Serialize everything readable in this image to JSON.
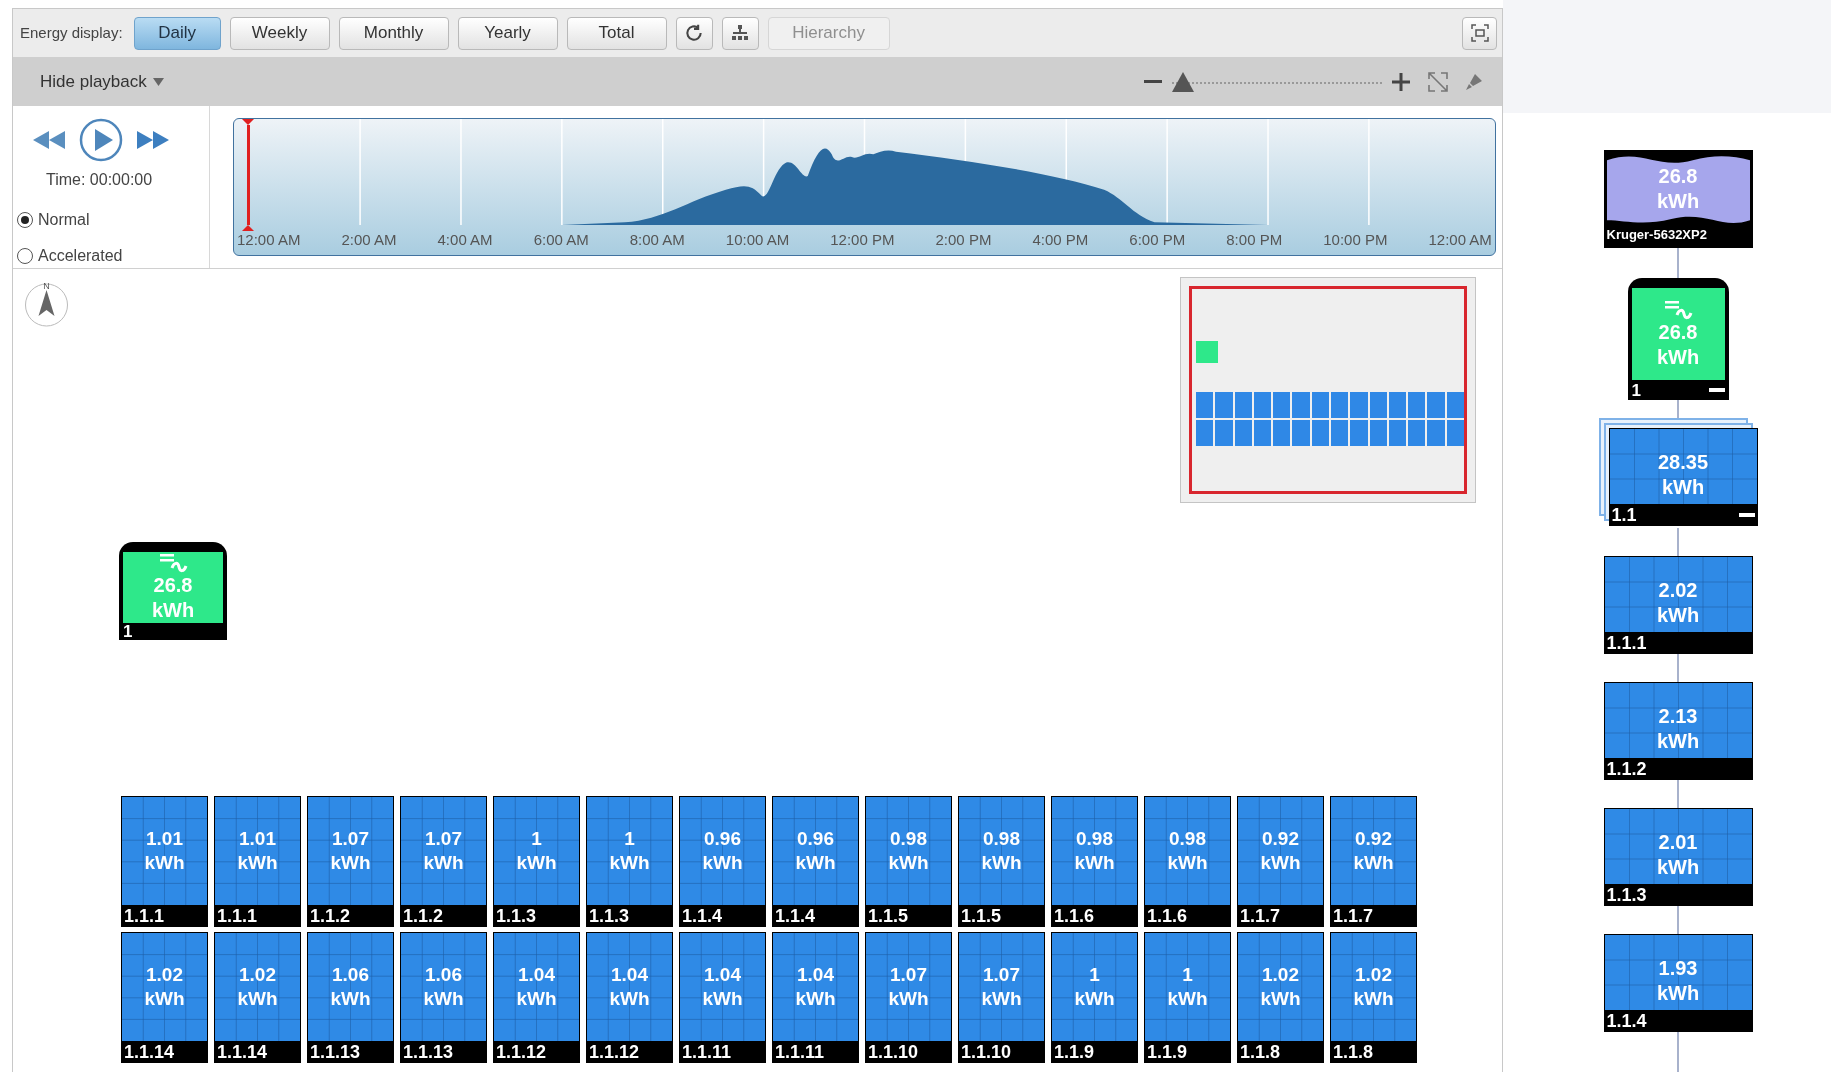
{
  "toolbar": {
    "label": "Energy display:",
    "periods": [
      {
        "label": "Daily",
        "selected": true
      },
      {
        "label": "Weekly",
        "selected": false
      },
      {
        "label": "Monthly",
        "selected": false
      },
      {
        "label": "Yearly",
        "selected": false
      },
      {
        "label": "Total",
        "selected": false
      }
    ],
    "hierarchy": {
      "label": "Hierarchy",
      "disabled": true
    }
  },
  "playback_bar": {
    "toggle": "Hide playback",
    "zoom": {
      "level": 0
    }
  },
  "playback": {
    "time": "Time: 00:00:00",
    "modes": [
      {
        "label": "Normal",
        "selected": true
      },
      {
        "label": "Accelerated",
        "selected": false
      }
    ],
    "timeline": {
      "cursor": {
        "level": 0
      },
      "labels": [
        "12:00 AM",
        "2:00 AM",
        "4:00 AM",
        "6:00 AM",
        "8:00 AM",
        "10:00 AM",
        "12:00 PM",
        "2:00 PM",
        "4:00 PM",
        "6:00 PM",
        "8:00 PM",
        "10:00 PM",
        "12:00 AM"
      ]
    }
  },
  "canvas": {
    "compass": {
      "label": "N"
    },
    "inverter": {
      "value": "26.8",
      "unit": "kWh",
      "label": "1"
    },
    "panel_rows": [
      [
        {
          "value": "1.01",
          "unit": "kWh",
          "label": "1.1.1"
        },
        {
          "value": "1.01",
          "unit": "kWh",
          "label": "1.1.1"
        },
        {
          "value": "1.07",
          "unit": "kWh",
          "label": "1.1.2"
        },
        {
          "value": "1.07",
          "unit": "kWh",
          "label": "1.1.2"
        },
        {
          "value": "1",
          "unit": "kWh",
          "label": "1.1.3"
        },
        {
          "value": "1",
          "unit": "kWh",
          "label": "1.1.3"
        },
        {
          "value": "0.96",
          "unit": "kWh",
          "label": "1.1.4"
        },
        {
          "value": "0.96",
          "unit": "kWh",
          "label": "1.1.4"
        },
        {
          "value": "0.98",
          "unit": "kWh",
          "label": "1.1.5"
        },
        {
          "value": "0.98",
          "unit": "kWh",
          "label": "1.1.5"
        },
        {
          "value": "0.98",
          "unit": "kWh",
          "label": "1.1.6"
        },
        {
          "value": "0.98",
          "unit": "kWh",
          "label": "1.1.6"
        },
        {
          "value": "0.92",
          "unit": "kWh",
          "label": "1.1.7"
        },
        {
          "value": "0.92",
          "unit": "kWh",
          "label": "1.1.7"
        }
      ],
      [
        {
          "value": "1.02",
          "unit": "kWh",
          "label": "1.1.14"
        },
        {
          "value": "1.02",
          "unit": "kWh",
          "label": "1.1.14"
        },
        {
          "value": "1.06",
          "unit": "kWh",
          "label": "1.1.13"
        },
        {
          "value": "1.06",
          "unit": "kWh",
          "label": "1.1.13"
        },
        {
          "value": "1.04",
          "unit": "kWh",
          "label": "1.1.12"
        },
        {
          "value": "1.04",
          "unit": "kWh",
          "label": "1.1.12"
        },
        {
          "value": "1.04",
          "unit": "kWh",
          "label": "1.1.11"
        },
        {
          "value": "1.04",
          "unit": "kWh",
          "label": "1.1.11"
        },
        {
          "value": "1.07",
          "unit": "kWh",
          "label": "1.1.10"
        },
        {
          "value": "1.07",
          "unit": "kWh",
          "label": "1.1.10"
        },
        {
          "value": "1",
          "unit": "kWh",
          "label": "1.1.9"
        },
        {
          "value": "1",
          "unit": "kWh",
          "label": "1.1.9"
        },
        {
          "value": "1.02",
          "unit": "kWh",
          "label": "1.1.8"
        },
        {
          "value": "1.02",
          "unit": "kWh",
          "label": "1.1.8"
        }
      ]
    ]
  },
  "tree": [
    {
      "kind": "plant",
      "value": "26.8",
      "unit": "kWh",
      "label": "Kruger-5632XP2"
    },
    {
      "kind": "inverter",
      "value": "26.8",
      "unit": "kWh",
      "label": "1",
      "expanded": true
    },
    {
      "kind": "string",
      "value": "28.35",
      "unit": "kWh",
      "label": "1.1",
      "expanded": true
    },
    {
      "kind": "panel",
      "value": "2.02",
      "unit": "kWh",
      "label": "1.1.1"
    },
    {
      "kind": "panel",
      "value": "2.13",
      "unit": "kWh",
      "label": "1.1.2"
    },
    {
      "kind": "panel",
      "value": "2.01",
      "unit": "kWh",
      "label": "1.1.3"
    },
    {
      "kind": "panel",
      "value": "1.93",
      "unit": "kWh",
      "label": "1.1.4"
    }
  ]
}
